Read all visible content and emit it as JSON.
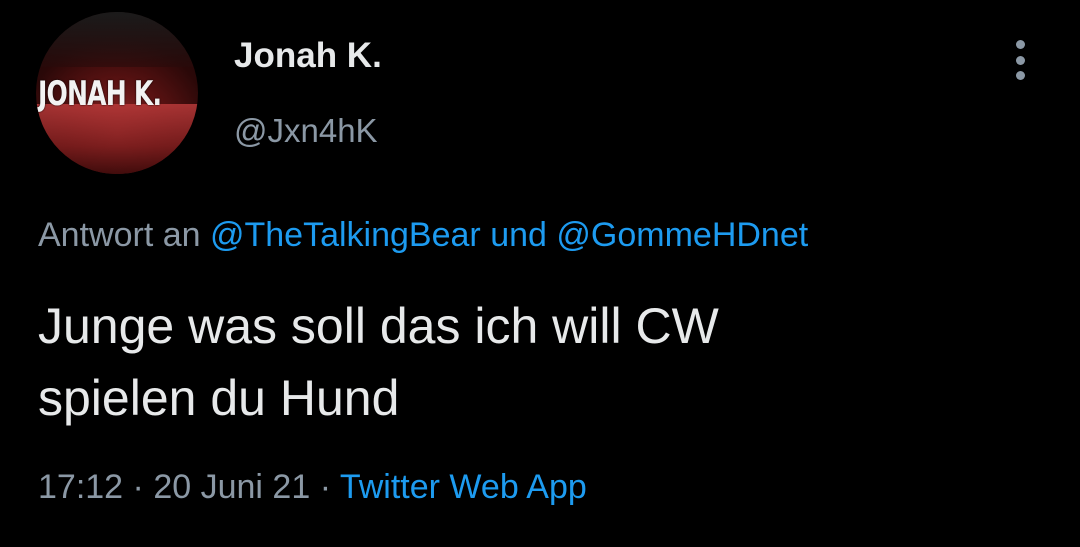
{
  "author": {
    "avatar_text": "JONAH K.",
    "display_name": "Jonah K.",
    "handle": "@Jxn4hK"
  },
  "reply": {
    "prefix": "Antwort an",
    "mention_1": "@TheTalkingBear",
    "conjunction": "und",
    "mention_2": "@GommeHDnet"
  },
  "tweet": {
    "line_1": "Junge was soll das ich will CW",
    "line_2": "spielen du Hund"
  },
  "meta": {
    "time": "17:12",
    "separator_1": "·",
    "date": "20 Juni 21",
    "separator_2": "·",
    "source": "Twitter Web App"
  },
  "icons": {
    "more": "more-vertical-icon"
  },
  "colors": {
    "background": "#000000",
    "primary_text": "#e7e9ea",
    "secondary_text": "#8b98a5",
    "link": "#1d9bf0"
  }
}
